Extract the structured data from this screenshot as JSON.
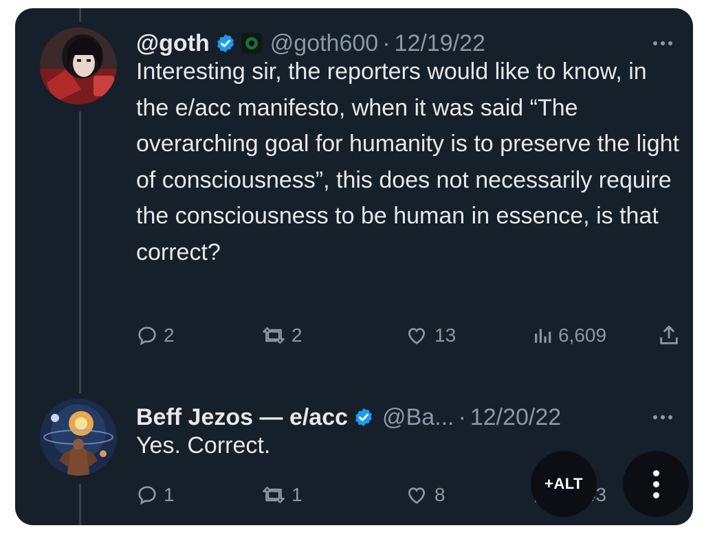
{
  "tweets": [
    {
      "display_name": "@goth",
      "handle": "@goth600",
      "separator": "·",
      "date": "12/19/22",
      "text": "Interesting sir, the reporters would like to know, in the e/acc manifesto, when it was said “The overarching goal for humanity is to preserve the light of consciousness”, this does not necessarily require the consciousness to be human in essence, is that correct?",
      "stats": {
        "replies": "2",
        "retweets": "2",
        "likes": "13",
        "views": "6,609"
      }
    },
    {
      "display_name": "Beff Jezos — e/acc",
      "handle": "@Ba...",
      "separator": "·",
      "date": "12/20/22",
      "text": "Yes. Correct.",
      "stats": {
        "replies": "1",
        "retweets": "1",
        "likes": "8",
        "views": "3,343"
      }
    }
  ],
  "overlay": {
    "alt_label": "+ALT"
  },
  "colors": {
    "background": "#15202b",
    "text": "#e7e9ea",
    "muted": "#8b98a5",
    "verified": "#1d9bf0"
  },
  "icons": [
    "reply-icon",
    "retweet-icon",
    "like-icon",
    "views-icon",
    "share-icon",
    "verified-icon",
    "more-icon"
  ]
}
